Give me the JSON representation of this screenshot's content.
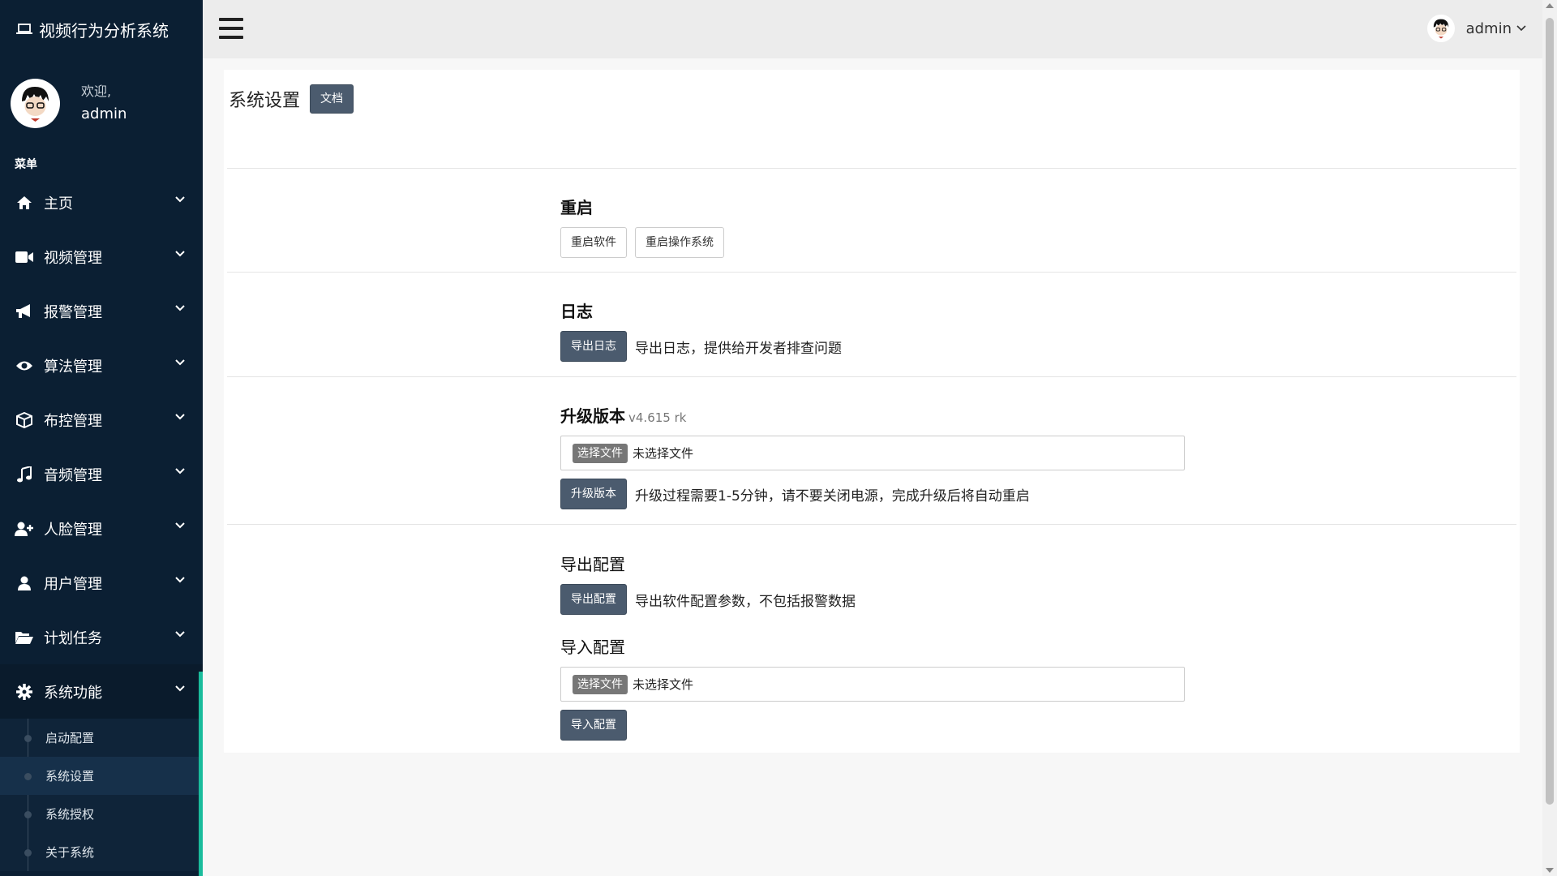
{
  "app": {
    "title": "视频行为分析系统"
  },
  "profile": {
    "welcome": "欢迎,",
    "name": "admin"
  },
  "menu": {
    "title": "菜单",
    "items": [
      {
        "label": "主页",
        "icon": "home-icon"
      },
      {
        "label": "视频管理",
        "icon": "video-camera-icon"
      },
      {
        "label": "报警管理",
        "icon": "megaphone-icon"
      },
      {
        "label": "算法管理",
        "icon": "eye-icon"
      },
      {
        "label": "布控管理",
        "icon": "cube-icon"
      },
      {
        "label": "音频管理",
        "icon": "music-icon"
      },
      {
        "label": "人脸管理",
        "icon": "user-plus-icon"
      },
      {
        "label": "用户管理",
        "icon": "user-icon"
      },
      {
        "label": "计划任务",
        "icon": "folder-open-icon"
      },
      {
        "label": "系统功能",
        "icon": "gear-icon"
      }
    ],
    "submenu": [
      {
        "label": "启动配置"
      },
      {
        "label": "系统设置"
      },
      {
        "label": "系统授权"
      },
      {
        "label": "关于系统"
      }
    ],
    "active_submenu": "系统设置"
  },
  "topbar": {
    "user": "admin"
  },
  "page": {
    "title": "系统设置",
    "doc_button": "文档"
  },
  "restart": {
    "title": "重启",
    "btn_software": "重启软件",
    "btn_os": "重启操作系统"
  },
  "logs": {
    "title": "日志",
    "btn_export": "导出日志",
    "desc": "导出日志，提供给开发者排查问题"
  },
  "upgrade": {
    "title": "升级版本",
    "version": "v4.615 rk",
    "file_btn": "选择文件",
    "file_status": "未选择文件",
    "btn_upgrade": "升级版本",
    "desc": "升级过程需要1-5分钟，请不要关闭电源，完成升级后将自动重启"
  },
  "export_config": {
    "title": "导出配置",
    "btn": "导出配置",
    "desc": "导出软件配置参数，不包括报警数据"
  },
  "import_config": {
    "title": "导入配置",
    "file_btn": "选择文件",
    "file_status": "未选择文件",
    "btn": "导入配置"
  },
  "colors": {
    "sidebar_bg": "#0b1f33",
    "accent": "#1abc9c",
    "button_dark": "#4b5b6e"
  }
}
